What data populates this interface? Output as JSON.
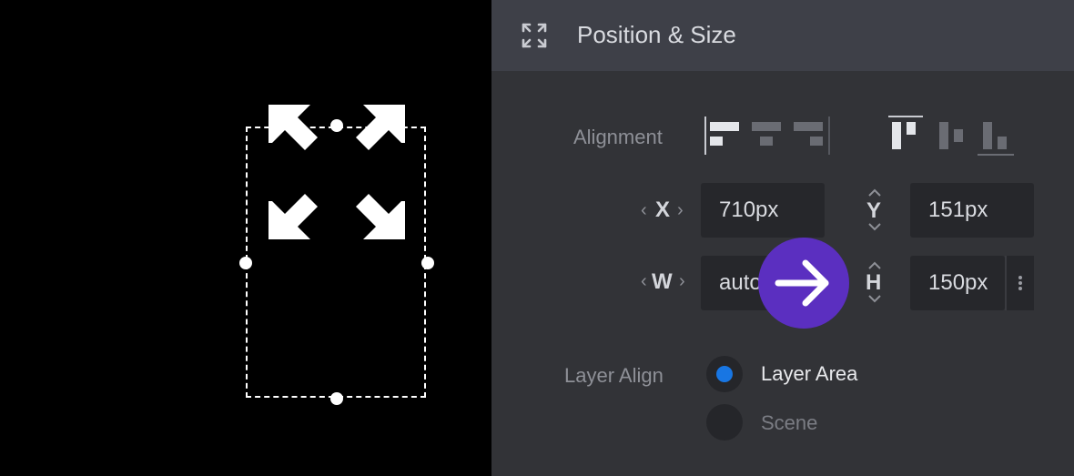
{
  "panel": {
    "title": "Position & Size",
    "header_icon": "expand-arrows-icon"
  },
  "alignment": {
    "label": "Alignment",
    "horizontal_options": [
      "align-left",
      "align-center",
      "align-right"
    ],
    "horizontal_selected": "align-left",
    "vertical_options": [
      "align-top",
      "align-middle",
      "align-bottom"
    ],
    "vertical_selected": "align-top"
  },
  "position": {
    "x_label": "X",
    "x_value": "710px",
    "y_label": "Y",
    "y_value": "151px"
  },
  "size": {
    "w_label": "W",
    "w_value": "auto",
    "h_label": "H",
    "h_value": "150px"
  },
  "layer_align": {
    "label": "Layer Align",
    "options": [
      {
        "label": "Layer Area",
        "selected": true
      },
      {
        "label": "Scene",
        "selected": false
      }
    ]
  },
  "colors": {
    "accent_radio": "#1876e3",
    "fab": "#5b2fc0",
    "panel_bg": "#323337",
    "header_bg": "#3e4048"
  }
}
